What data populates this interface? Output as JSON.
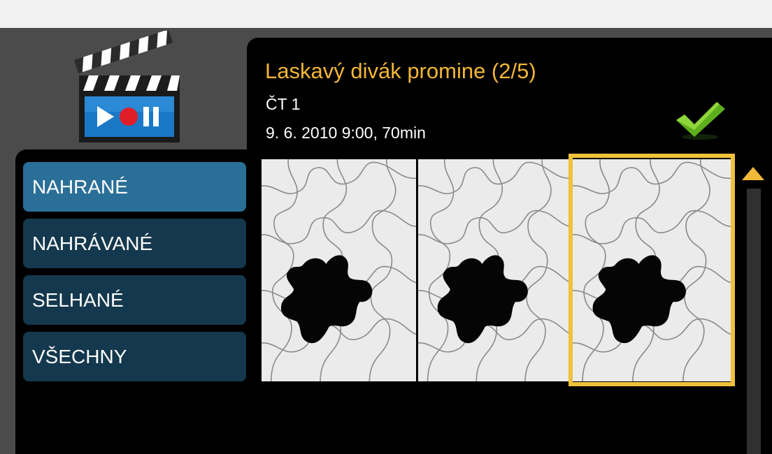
{
  "app": {
    "icon": "clapperboard-record-icon"
  },
  "recording": {
    "title": "Laskavý divák promine (2/5)",
    "channel": "ČT 1",
    "datetime": "9. 6. 2010 9:00, 70min",
    "status_icon": "checkmark-icon"
  },
  "nav": {
    "items": [
      {
        "label": "NAHRANÉ",
        "active": true
      },
      {
        "label": "NAHRÁVANÉ",
        "active": false
      },
      {
        "label": "SELHANÉ",
        "active": false
      },
      {
        "label": "VŠECHNY",
        "active": false
      }
    ]
  },
  "thumbnails": {
    "count": 3,
    "selected_index": 2,
    "image": "puzzle-missing-piece-thumbnail"
  },
  "scrollbar": {
    "up_icon": "triangle-up-icon"
  },
  "colors": {
    "accent": "#f3b636",
    "nav_active": "#2a6f98",
    "nav_inactive": "#14384d",
    "selection": "#f0c13a"
  }
}
